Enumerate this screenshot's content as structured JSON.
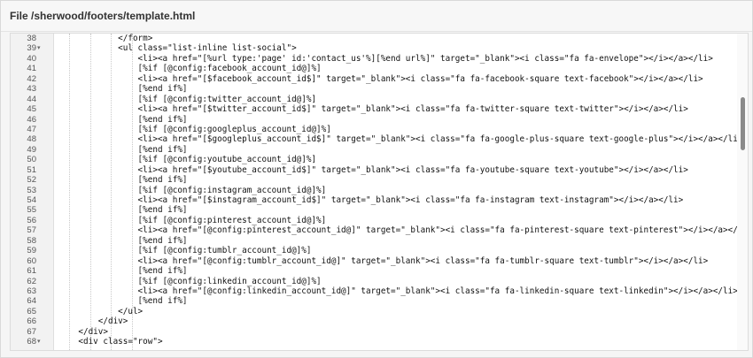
{
  "header": {
    "title": "File /sherwood/footers/template.html"
  },
  "icons": {
    "fold_marker": "fold-caret-icon"
  },
  "editor": {
    "lines": [
      {
        "num": "38",
        "text": "            </form>",
        "fold": ""
      },
      {
        "num": "39",
        "text": "            <ul class=\"list-inline list-social\">",
        "fold": "▾"
      },
      {
        "num": "40",
        "text": "                <li><a href=\"[%url type:'page' id:'contact_us'%][%end url%]\" target=\"_blank\"><i class=\"fa fa-envelope\"></i></a></li>",
        "fold": ""
      },
      {
        "num": "41",
        "text": "                [%if [@config:facebook_account_id@]%]",
        "fold": ""
      },
      {
        "num": "42",
        "text": "                <li><a href=\"[$facebook_account_id$]\" target=\"_blank\"><i class=\"fa fa-facebook-square text-facebook\"></i></a></li>",
        "fold": ""
      },
      {
        "num": "43",
        "text": "                [%end if%]",
        "fold": ""
      },
      {
        "num": "44",
        "text": "                [%if [@config:twitter_account_id@]%]",
        "fold": ""
      },
      {
        "num": "45",
        "text": "                <li><a href=\"[$twitter_account_id$]\" target=\"_blank\"><i class=\"fa fa-twitter-square text-twitter\"></i></a></li>",
        "fold": ""
      },
      {
        "num": "46",
        "text": "                [%end if%]",
        "fold": ""
      },
      {
        "num": "47",
        "text": "                [%if [@config:googleplus_account_id@]%]",
        "fold": ""
      },
      {
        "num": "48",
        "text": "                <li><a href=\"[$googleplus_account_id$]\" target=\"_blank\"><i class=\"fa fa-google-plus-square text-google-plus\"></i></a></li>",
        "fold": ""
      },
      {
        "num": "49",
        "text": "                [%end if%]",
        "fold": ""
      },
      {
        "num": "50",
        "text": "                [%if [@config:youtube_account_id@]%]",
        "fold": ""
      },
      {
        "num": "51",
        "text": "                <li><a href=\"[$youtube_account_id$]\" target=\"_blank\"><i class=\"fa fa-youtube-square text-youtube\"></i></a></li>",
        "fold": ""
      },
      {
        "num": "52",
        "text": "                [%end if%]",
        "fold": ""
      },
      {
        "num": "53",
        "text": "                [%if [@config:instagram_account_id@]%]",
        "fold": ""
      },
      {
        "num": "54",
        "text": "                <li><a href=\"[$instagram_account_id$]\" target=\"_blank\"><i class=\"fa fa-instagram text-instagram\"></i></a></li>",
        "fold": ""
      },
      {
        "num": "55",
        "text": "                [%end if%]",
        "fold": ""
      },
      {
        "num": "56",
        "text": "                [%if [@config:pinterest_account_id@]%]",
        "fold": ""
      },
      {
        "num": "57",
        "text": "                <li><a href=\"[@config:pinterest_account_id@]\" target=\"_blank\"><i class=\"fa fa-pinterest-square text-pinterest\"></i></a></li>",
        "fold": ""
      },
      {
        "num": "58",
        "text": "                [%end if%]",
        "fold": ""
      },
      {
        "num": "59",
        "text": "                [%if [@config:tumblr_account_id@]%]",
        "fold": ""
      },
      {
        "num": "60",
        "text": "                <li><a href=\"[@config:tumblr_account_id@]\" target=\"_blank\"><i class=\"fa fa-tumblr-square text-tumblr\"></i></a></li>",
        "fold": ""
      },
      {
        "num": "61",
        "text": "                [%end if%]",
        "fold": ""
      },
      {
        "num": "62",
        "text": "                [%if [@config:linkedin_account_id@]%]",
        "fold": ""
      },
      {
        "num": "63",
        "text": "                <li><a href=\"[@config:linkedin_account_id@]\" target=\"_blank\"><i class=\"fa fa-linkedin-square text-linkedin\"></i></a></li>",
        "fold": ""
      },
      {
        "num": "64",
        "text": "                [%end if%]",
        "fold": ""
      },
      {
        "num": "65",
        "text": "            </ul>",
        "fold": ""
      },
      {
        "num": "66",
        "text": "        </div>",
        "fold": ""
      },
      {
        "num": "67",
        "text": "    </div>",
        "fold": ""
      },
      {
        "num": "68",
        "text": "    <div class=\"row\">",
        "fold": "▾"
      }
    ]
  }
}
